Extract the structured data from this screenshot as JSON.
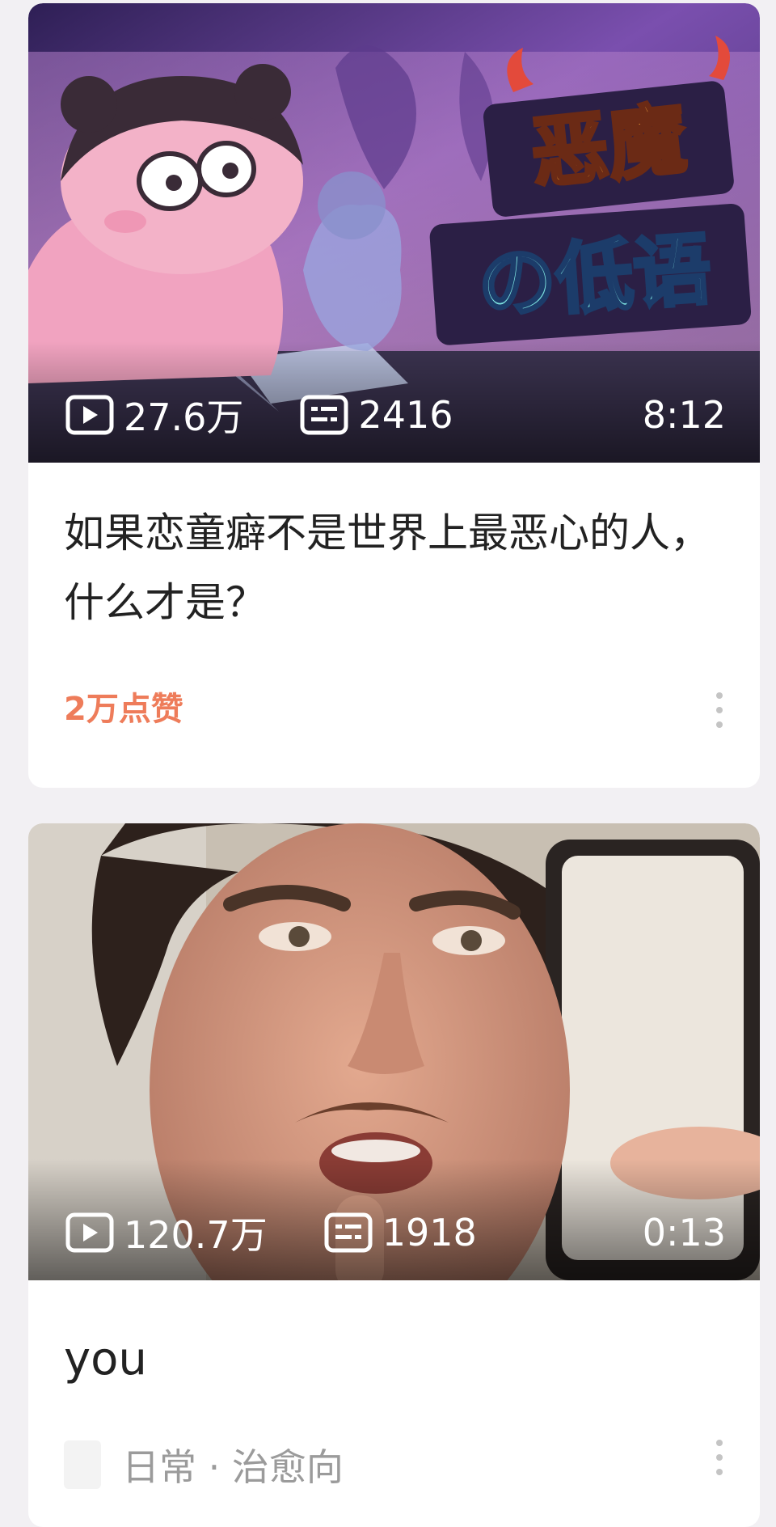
{
  "feed": [
    {
      "views": "27.6万",
      "comments": "2416",
      "duration": "8:12",
      "title": "如果恋童癖不是世界上最恶心的人，什么才是？",
      "likes": "2万点赞",
      "cover_text_line1": "恶魔",
      "cover_text_line2": "の低语"
    },
    {
      "views": "120.7万",
      "comments": "1918",
      "duration": "0:13",
      "title": "you",
      "tag": "日常 · 治愈向"
    }
  ],
  "colors": {
    "likes": "#ee7c5a",
    "background": "#f2f0f3",
    "cover_bg": "#7b4fa8"
  },
  "icons": [
    "play-icon",
    "danmaku-icon",
    "more-icon"
  ]
}
